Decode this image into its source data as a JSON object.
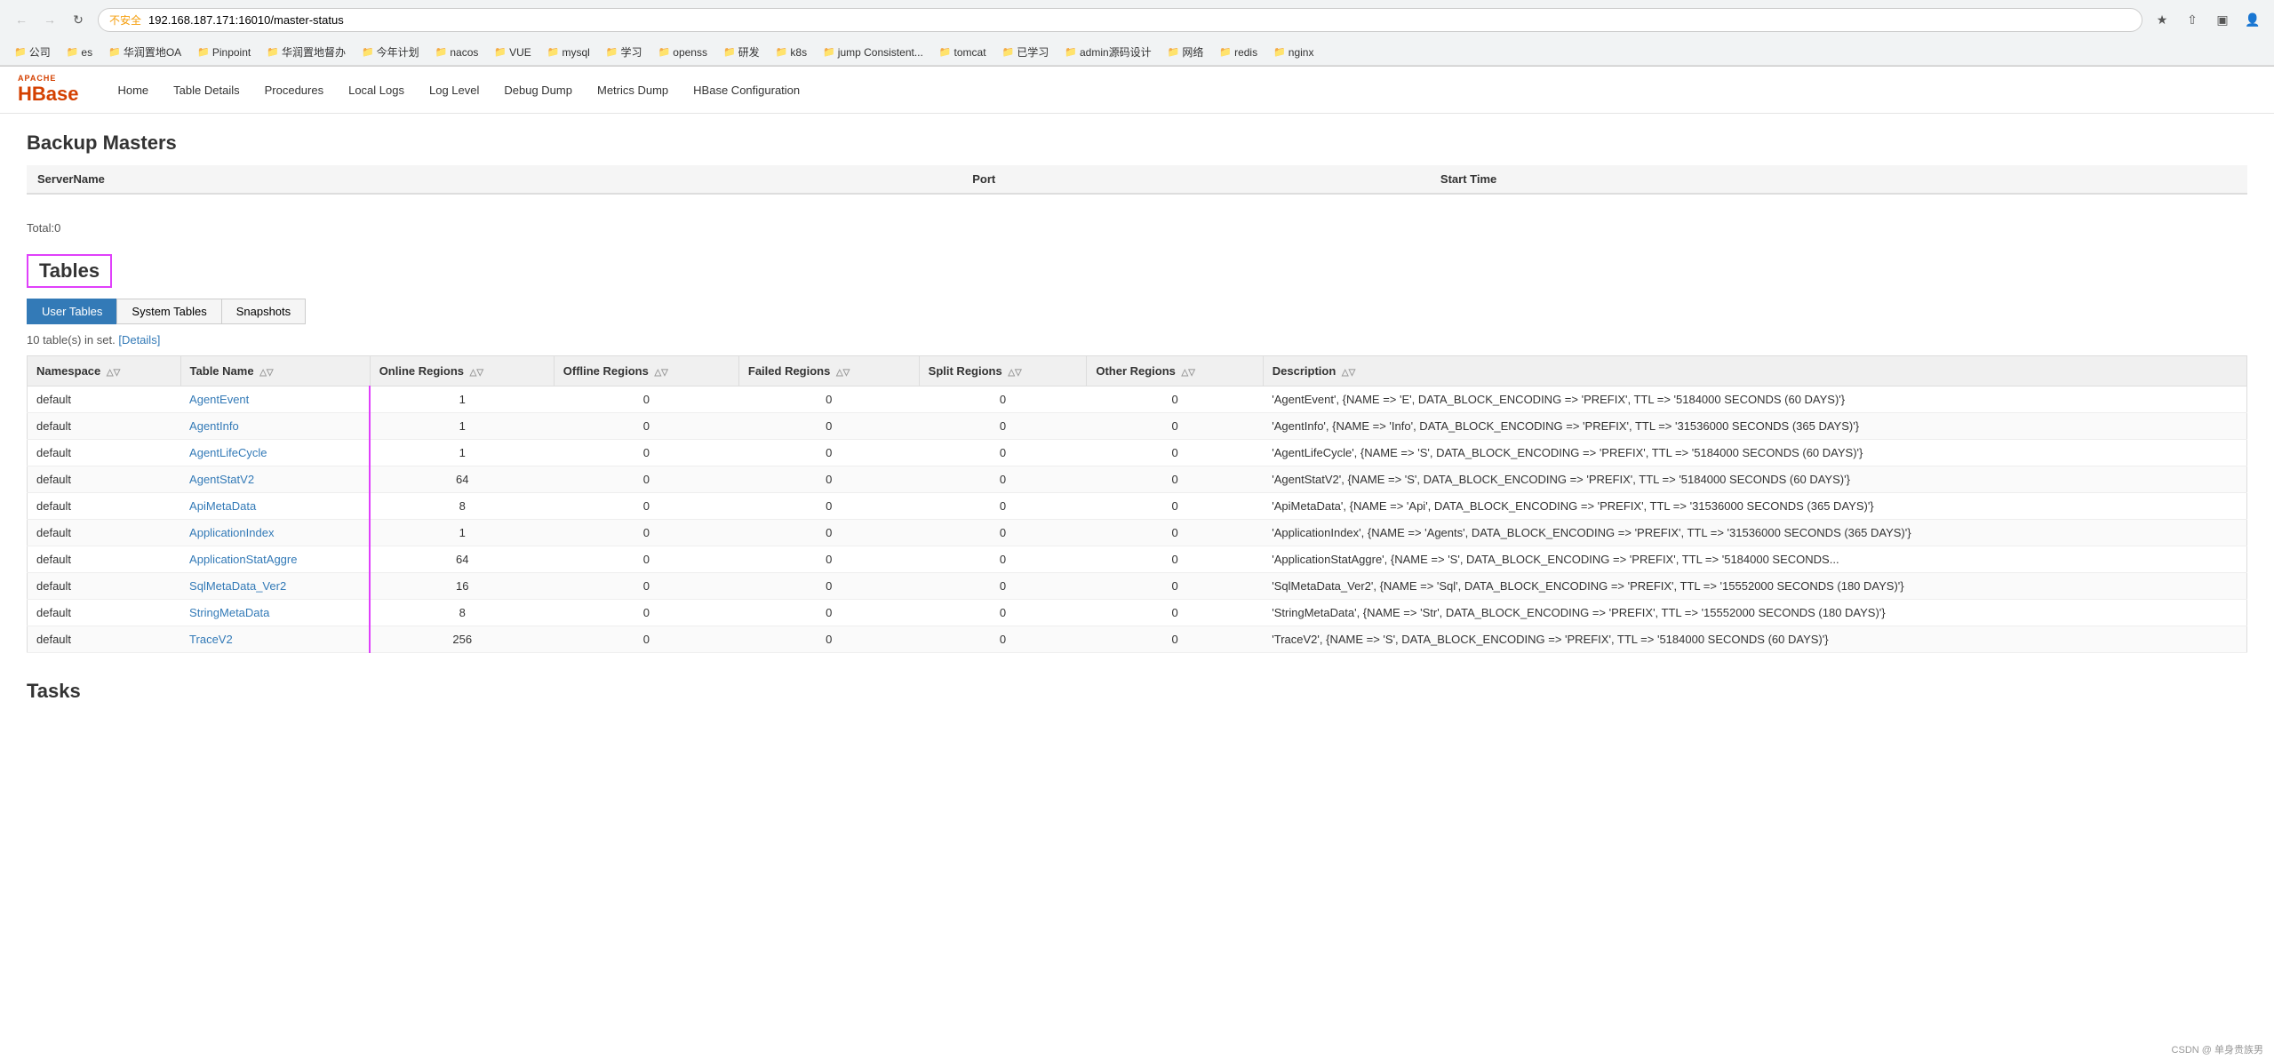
{
  "browser": {
    "url": "192.168.187.171:16010/master-status",
    "warning_text": "不安全",
    "back_disabled": false,
    "forward_disabled": false
  },
  "bookmarks": [
    {
      "label": "公司",
      "type": "folder"
    },
    {
      "label": "es",
      "type": "folder"
    },
    {
      "label": "华润置地OA",
      "type": "folder"
    },
    {
      "label": "Pinpoint",
      "type": "folder"
    },
    {
      "label": "华润置地督办",
      "type": "folder"
    },
    {
      "label": "今年计划",
      "type": "folder"
    },
    {
      "label": "nacos",
      "type": "folder"
    },
    {
      "label": "VUE",
      "type": "folder"
    },
    {
      "label": "mysql",
      "type": "folder"
    },
    {
      "label": "学习",
      "type": "folder"
    },
    {
      "label": "openss",
      "type": "folder"
    },
    {
      "label": "研发",
      "type": "folder"
    },
    {
      "label": "k8s",
      "type": "folder"
    },
    {
      "label": "jump Consistent...",
      "type": "folder"
    },
    {
      "label": "tomcat",
      "type": "folder"
    },
    {
      "label": "已学习",
      "type": "folder"
    },
    {
      "label": "admin源码设计",
      "type": "folder"
    },
    {
      "label": "网络",
      "type": "folder"
    },
    {
      "label": "redis",
      "type": "folder"
    },
    {
      "label": "nginx",
      "type": "folder"
    }
  ],
  "nav": {
    "home": "Home",
    "table_details": "Table Details",
    "procedures": "Procedures",
    "local_logs": "Local Logs",
    "log_level": "Log Level",
    "debug_dump": "Debug Dump",
    "metrics_dump": "Metrics Dump",
    "hbase_config": "HBase Configuration"
  },
  "backup_masters": {
    "title": "Backup Masters",
    "columns": [
      "ServerName",
      "Port",
      "Start Time"
    ],
    "total": "Total:0"
  },
  "tables": {
    "title": "Tables",
    "tabs": [
      "User Tables",
      "System Tables",
      "Snapshots"
    ],
    "active_tab": "User Tables",
    "info": "10 table(s) in set.",
    "details_link": "[Details]",
    "columns": [
      "Namespace",
      "Table Name",
      "Online Regions",
      "Offline Regions",
      "Failed Regions",
      "Split Regions",
      "Other Regions",
      "Description"
    ],
    "rows": [
      {
        "namespace": "default",
        "table_name": "AgentEvent",
        "online_regions": "1",
        "offline_regions": "0",
        "failed_regions": "0",
        "split_regions": "0",
        "other_regions": "0",
        "description": "'AgentEvent', {NAME => 'E', DATA_BLOCK_ENCODING => 'PREFIX', TTL => '5184000 SECONDS (60 DAYS)'}"
      },
      {
        "namespace": "default",
        "table_name": "AgentInfo",
        "online_regions": "1",
        "offline_regions": "0",
        "failed_regions": "0",
        "split_regions": "0",
        "other_regions": "0",
        "description": "'AgentInfo', {NAME => 'Info', DATA_BLOCK_ENCODING => 'PREFIX', TTL => '31536000 SECONDS (365 DAYS)'}"
      },
      {
        "namespace": "default",
        "table_name": "AgentLifeCycle",
        "online_regions": "1",
        "offline_regions": "0",
        "failed_regions": "0",
        "split_regions": "0",
        "other_regions": "0",
        "description": "'AgentLifeCycle', {NAME => 'S', DATA_BLOCK_ENCODING => 'PREFIX', TTL => '5184000 SECONDS (60 DAYS)'}"
      },
      {
        "namespace": "default",
        "table_name": "AgentStatV2",
        "online_regions": "64",
        "offline_regions": "0",
        "failed_regions": "0",
        "split_regions": "0",
        "other_regions": "0",
        "description": "'AgentStatV2', {NAME => 'S', DATA_BLOCK_ENCODING => 'PREFIX', TTL => '5184000 SECONDS (60 DAYS)'}"
      },
      {
        "namespace": "default",
        "table_name": "ApiMetaData",
        "online_regions": "8",
        "offline_regions": "0",
        "failed_regions": "0",
        "split_regions": "0",
        "other_regions": "0",
        "description": "'ApiMetaData', {NAME => 'Api', DATA_BLOCK_ENCODING => 'PREFIX', TTL => '31536000 SECONDS (365 DAYS)'}"
      },
      {
        "namespace": "default",
        "table_name": "ApplicationIndex",
        "online_regions": "1",
        "offline_regions": "0",
        "failed_regions": "0",
        "split_regions": "0",
        "other_regions": "0",
        "description": "'ApplicationIndex', {NAME => 'Agents', DATA_BLOCK_ENCODING => 'PREFIX', TTL => '31536000 SECONDS (365 DAYS)'}"
      },
      {
        "namespace": "default",
        "table_name": "ApplicationStatAggre",
        "online_regions": "64",
        "offline_regions": "0",
        "failed_regions": "0",
        "split_regions": "0",
        "other_regions": "0",
        "description": "'ApplicationStatAggre', {NAME => 'S', DATA_BLOCK_ENCODING => 'PREFIX', TTL => '5184000 SECONDS..."
      },
      {
        "namespace": "default",
        "table_name": "SqlMetaData_Ver2",
        "online_regions": "16",
        "offline_regions": "0",
        "failed_regions": "0",
        "split_regions": "0",
        "other_regions": "0",
        "description": "'SqlMetaData_Ver2', {NAME => 'Sql', DATA_BLOCK_ENCODING => 'PREFIX', TTL => '15552000 SECONDS (180 DAYS)'}"
      },
      {
        "namespace": "default",
        "table_name": "StringMetaData",
        "online_regions": "8",
        "offline_regions": "0",
        "failed_regions": "0",
        "split_regions": "0",
        "other_regions": "0",
        "description": "'StringMetaData', {NAME => 'Str', DATA_BLOCK_ENCODING => 'PREFIX', TTL => '15552000 SECONDS (180 DAYS)'}"
      },
      {
        "namespace": "default",
        "table_name": "TraceV2",
        "online_regions": "256",
        "offline_regions": "0",
        "failed_regions": "0",
        "split_regions": "0",
        "other_regions": "0",
        "description": "'TraceV2', {NAME => 'S', DATA_BLOCK_ENCODING => 'PREFIX', TTL => '5184000 SECONDS (60 DAYS)'}"
      }
    ]
  },
  "tasks": {
    "title": "Tasks"
  },
  "footer": {
    "text": "CSDN @ 单身贵族男"
  }
}
